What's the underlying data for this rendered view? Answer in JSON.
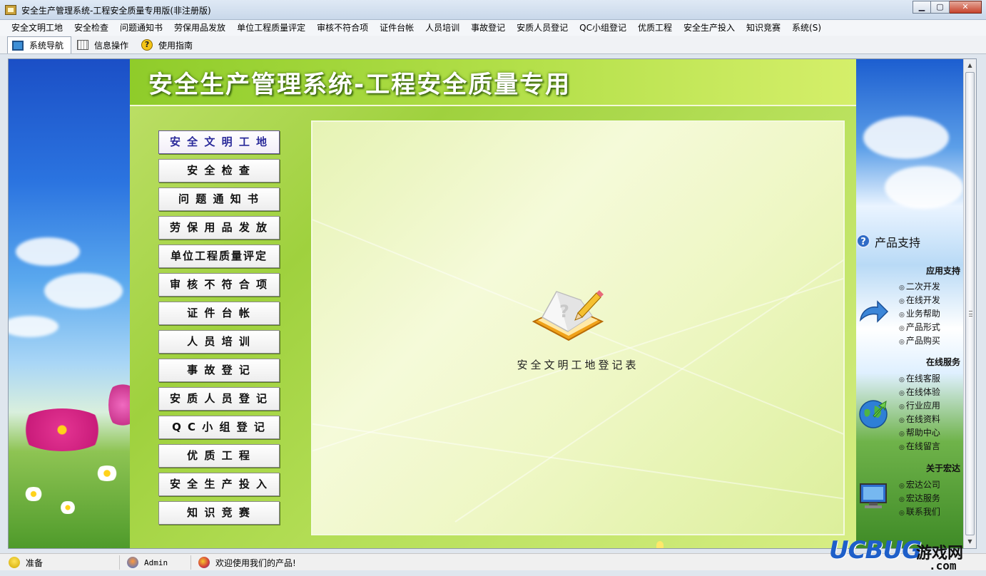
{
  "window": {
    "title": "安全生产管理系统-工程安全质量专用版(非注册版)",
    "buttons": {
      "minimize": "▁",
      "maximize": "▢",
      "close": "✕"
    }
  },
  "menu": [
    "安全文明工地",
    "安全检查",
    "问题通知书",
    "劳保用品发放",
    "单位工程质量评定",
    "审核不符合项",
    "证件台帐",
    "人员培训",
    "事故登记",
    "安质人员登记",
    "QC小组登记",
    "优质工程",
    "安全生产投入",
    "知识竞赛",
    "系统(S)"
  ],
  "toolbar": {
    "tabs": [
      {
        "label": "系统导航",
        "icon": "monitor-icon",
        "active": true
      },
      {
        "label": "信息操作",
        "icon": "grid-icon",
        "active": false
      },
      {
        "label": "使用指南",
        "icon": "help-icon",
        "active": false
      }
    ]
  },
  "main": {
    "system_title": "安全生产管理系统-工程安全质量专用",
    "nav_buttons": [
      "安 全 文 明 工 地",
      "安  全  检  查",
      "问 题 通 知 书",
      "劳 保 用 品 发 放",
      "单位工程质量评定",
      "审 核 不 符 合 项",
      "证   件   台   帐",
      "人   员   培   训",
      "事   故   登   记",
      "安 质 人 员 登 记",
      "Q C 小 组 登 记",
      "优   质   工   程",
      "安 全 生 产 投 入",
      "知   识   竞   赛"
    ],
    "selected_index": 0,
    "content_caption": "安全文明工地登记表",
    "book_icon": "book-pencil-icon"
  },
  "right_panel": {
    "support_title": "产品支持",
    "sections": [
      {
        "title": "应用支持",
        "links": [
          "二次开发",
          "在线开发",
          "业务帮助",
          "产品形式",
          "产品购买"
        ]
      },
      {
        "title": "在线服务",
        "links": [
          "在线客服",
          "在线体验",
          "行业应用",
          "在线资料",
          "帮助中心",
          "在线留言"
        ]
      },
      {
        "title": "关于宏达",
        "links": [
          "宏达公司",
          "宏达服务",
          "联系我们"
        ]
      }
    ]
  },
  "statusbar": {
    "ready": "准备",
    "user": "Admin",
    "welcome": "欢迎使用我们的产品!"
  },
  "watermark": {
    "brand": "UCBUG",
    "cn": "游戏网",
    "domain": ".com"
  },
  "colors": {
    "main_green": "#9fd13e",
    "title_blue": "#1e5fc9",
    "selected_text": "#2a2a9a"
  }
}
